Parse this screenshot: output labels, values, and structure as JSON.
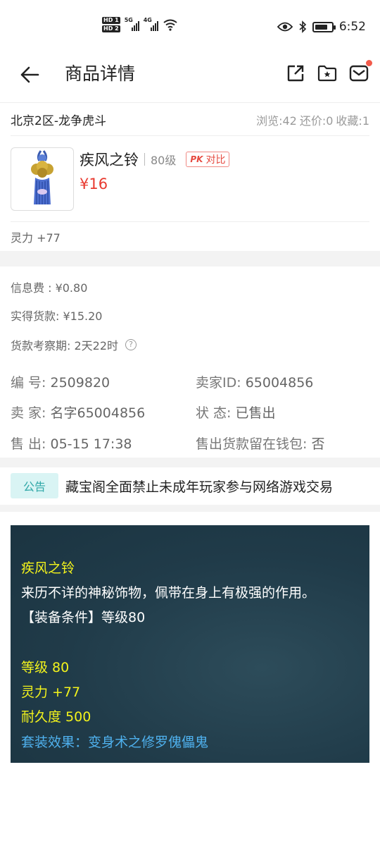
{
  "status_bar": {
    "hd1": "HD 1",
    "hd2": "HD 2",
    "net1": "5G",
    "net2": "4G",
    "time": "6:52",
    "battery_level": 0.8
  },
  "header": {
    "title": "商品详情",
    "back_icon": "arrow-left-icon",
    "share_icon": "share-icon",
    "favorite_icon": "folder-star-icon",
    "mail_icon": "mail-icon",
    "mail_badge_color": "#f25a4a"
  },
  "server": {
    "name": "北京2区-龙争虎斗",
    "views": "浏览:42",
    "bargains": "还价:0",
    "favorites": "收藏:1"
  },
  "product": {
    "name": "疾风之铃",
    "level": "80级",
    "pk_tag": "PK",
    "compare_label": "对比",
    "price": "¥16",
    "attribute": "灵力 +77"
  },
  "fees": {
    "info_fee": "信息费 : ¥0.80",
    "actual_payment": "实得货款:  ¥15.20",
    "review_period": "货款考察期:  2天22时"
  },
  "info": {
    "number_label": "编   号:",
    "number_value": "2509820",
    "seller_id_label": "卖家ID:",
    "seller_id_value": "65004856",
    "seller_label": "卖   家:",
    "seller_value": "名字65004856",
    "status_label": "状   态:",
    "status_value": "已售出",
    "sold_label": "售   出:",
    "sold_value": "05-15 17:38",
    "wallet_label": "售出货款留在钱包:",
    "wallet_value": "否"
  },
  "notice": {
    "tag": "公告",
    "text": "藏宝阁全面禁止未成年玩家参与网络游戏交易"
  },
  "item_panel": {
    "name": "疾风之铃",
    "description": "来历不详的神秘饰物，佩带在身上有极强的作用。",
    "requirement": "【装备条件】等级80",
    "level": "等级 80",
    "spirit": "灵力 +77",
    "durability": "耐久度 500",
    "set_effect": "套装效果：变身术之修罗傀儡鬼"
  },
  "colors": {
    "price_red": "#e83a30",
    "notice_teal": "#2fa7a7",
    "panel_bg": "#203b49",
    "panel_yellow": "#f3f31c",
    "panel_blue": "#4fb1ee"
  }
}
